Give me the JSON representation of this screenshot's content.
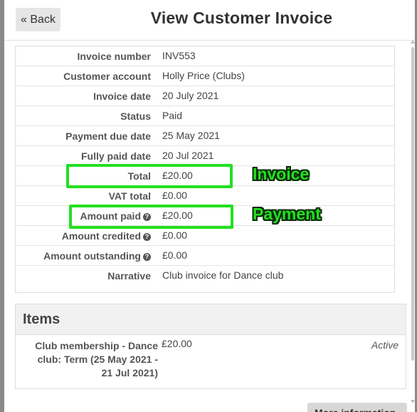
{
  "header": {
    "back_label": "« Back",
    "title": "View Customer Invoice"
  },
  "details": [
    {
      "label": "Invoice number",
      "value": "INV553",
      "help": false
    },
    {
      "label": "Customer account",
      "value": "Holly Price (Clubs)",
      "help": false
    },
    {
      "label": "Invoice date",
      "value": "20 July 2021",
      "help": false
    },
    {
      "label": "Status",
      "value": "Paid",
      "help": false
    },
    {
      "label": "Payment due date",
      "value": "25 May 2021",
      "help": false
    },
    {
      "label": "Fully paid date",
      "value": "20 Jul 2021",
      "help": false
    },
    {
      "label": "Total",
      "value": "£20.00",
      "help": false
    },
    {
      "label": "VAT total",
      "value": "£0.00",
      "help": false
    },
    {
      "label": "Amount paid",
      "value": "£20.00",
      "help": true
    },
    {
      "label": "Amount credited",
      "value": "£0.00",
      "help": true
    },
    {
      "label": "Amount outstanding",
      "value": "£0.00",
      "help": true
    },
    {
      "label": "Narrative",
      "value": "Club invoice for Dance club",
      "help": false
    }
  ],
  "annotations": {
    "invoice_label": "Invoice",
    "payment_label": "Payment",
    "color": "#22e01f"
  },
  "items": {
    "title": "Items",
    "rows": [
      {
        "name": "Club membership - Dance club: Term (25 May 2021 - 21 Jul 2021)",
        "price": "£20.00",
        "status": "Active"
      }
    ]
  },
  "footer": {
    "more_label": "More information"
  },
  "colors": {
    "accent_highlight": "#22e01f",
    "button_bg": "#e6e6e6",
    "panel_header_bg": "#f1f1f1"
  }
}
